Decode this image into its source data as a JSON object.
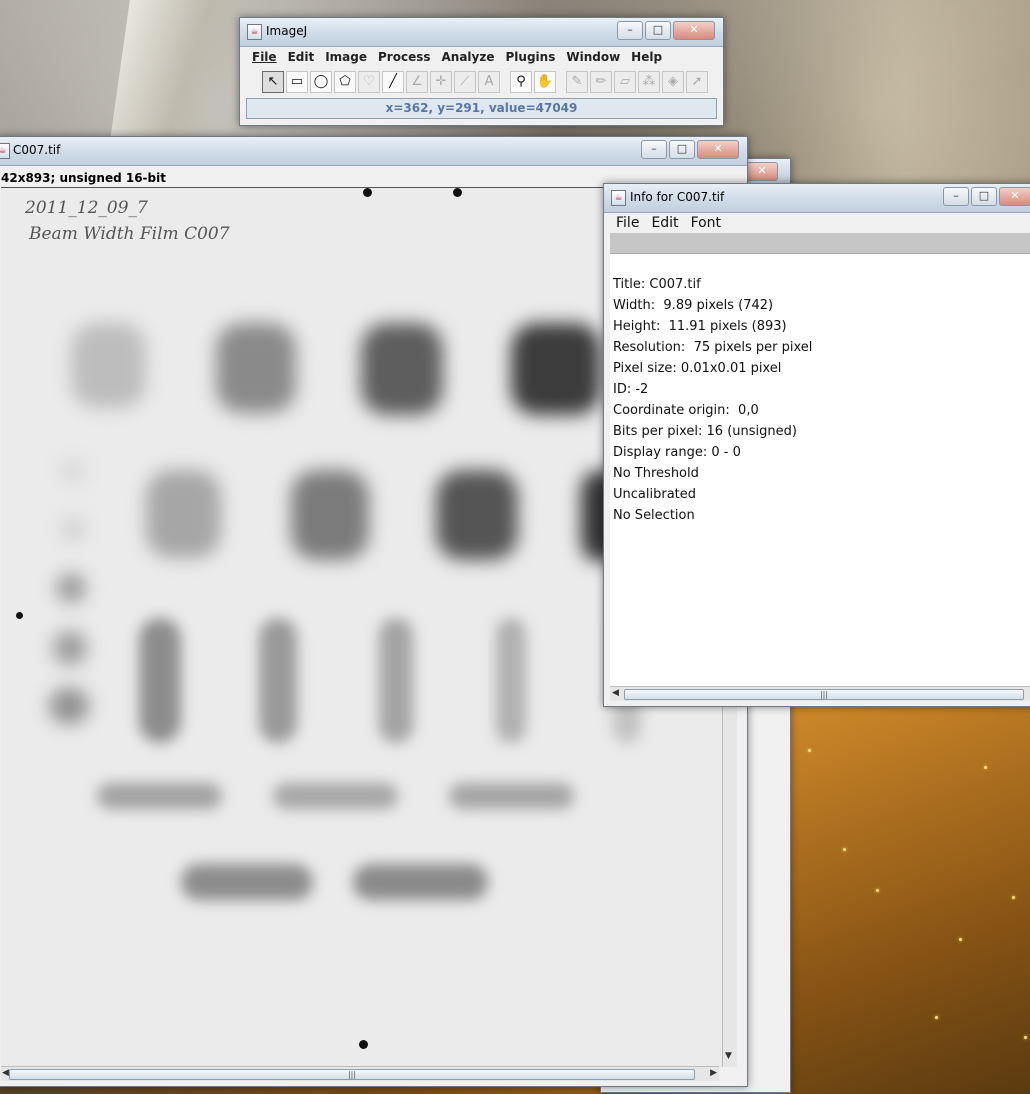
{
  "imagej_window": {
    "title": "ImageJ",
    "menu": [
      "File",
      "Edit",
      "Image",
      "Process",
      "Analyze",
      "Plugins",
      "Window",
      "Help"
    ],
    "tools": [
      "pointer-arrow-icon",
      "rectangle-icon",
      "oval-icon",
      "polygon-icon",
      "freehand-icon",
      "line-icon",
      "angle-icon",
      "point-icon",
      "wand-icon",
      "text-icon",
      "magnifier-icon",
      "hand-icon",
      "brush-icon",
      "pencil-icon",
      "eraser-icon",
      "spray-icon",
      "flood-fill-icon",
      "arrow-icon"
    ],
    "status": "x=362, y=291, value=47049"
  },
  "image_window": {
    "title": "C007.tif",
    "subtitle": "42x893; unsigned 16-bit",
    "annotation_line1": "2011_12_09_7",
    "annotation_line2": "Beam Width Film C007"
  },
  "info_window": {
    "title": "Info for C007.tif",
    "menu": [
      "File",
      "Edit",
      "Font"
    ],
    "lines": [
      "Title: C007.tif",
      "Width:  9.89 pixels (742)",
      "Height:  11.91 pixels (893)",
      "Resolution:  75 pixels per pixel",
      "Pixel size: 0.01x0.01 pixel",
      "ID: -2",
      "Coordinate origin:  0,0",
      "Bits per pixel: 16 (unsigned)",
      "Display range: 0 - 0",
      "No Threshold",
      "Uncalibrated",
      "No Selection"
    ]
  },
  "window_controls": {
    "minimize": "–",
    "maximize": "□",
    "close": "✕"
  },
  "colors": {
    "status_text": "#5a76a8",
    "title_gradient_top": "#e9f0f7"
  }
}
